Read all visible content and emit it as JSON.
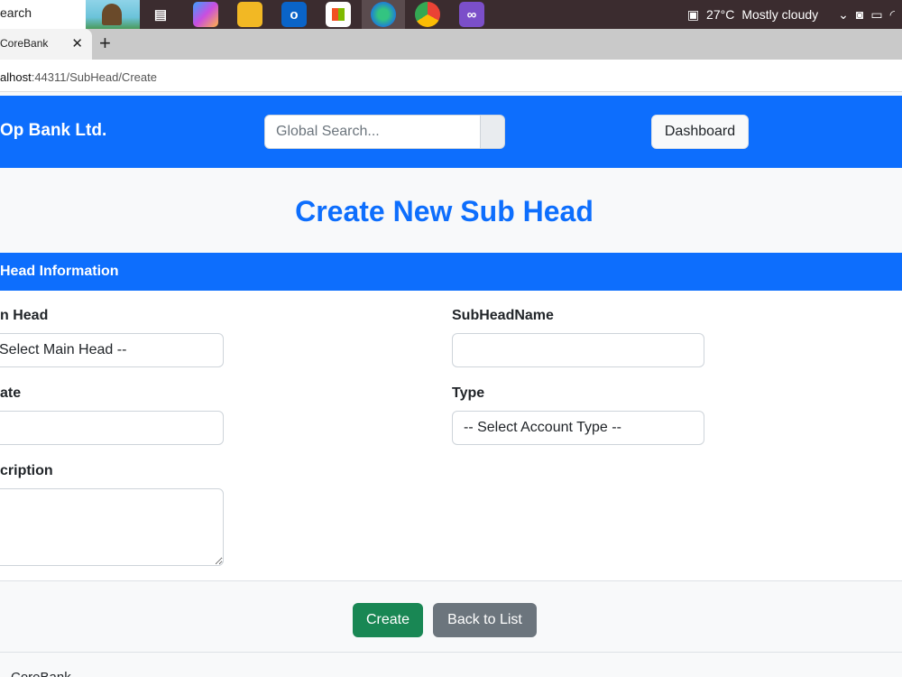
{
  "taskbar": {
    "search_label": "earch",
    "weather": "27°C",
    "weather_desc": "Mostly cloudy"
  },
  "browser": {
    "tab_title": "CoreBank",
    "tab_close": "✕",
    "new_tab": "+",
    "url_prefix": "alhost",
    "url_rest": ":44311/SubHead/Create"
  },
  "navbar": {
    "brand": "Op Bank Ltd.",
    "search_placeholder": "Global Search...",
    "dashboard_label": "Dashboard"
  },
  "page": {
    "title": "Create New Sub Head"
  },
  "card": {
    "header": "Head Information",
    "fields": {
      "main_head_label": "n Head",
      "main_head_value": "Select Main Head --",
      "subhead_name_label": "SubHeadName",
      "subhead_name_value": "",
      "date_label": "ate",
      "date_value": "",
      "type_label": "Type",
      "type_value": "-- Select Account Type --",
      "description_label": "cription",
      "description_value": ""
    }
  },
  "actions": {
    "create_label": "Create",
    "back_label": "Back to List"
  },
  "footer": {
    "text": "CoreBank"
  },
  "colors": {
    "primary": "#0d6efd",
    "success": "#198754",
    "secondary": "#6c757d"
  }
}
